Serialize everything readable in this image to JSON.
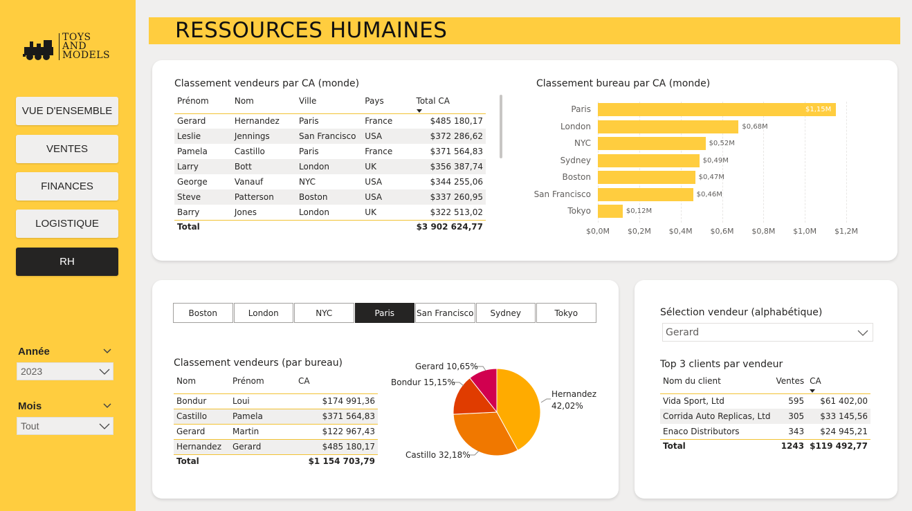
{
  "sidebar": {
    "logo": {
      "line1": "TOYS",
      "line2": "AND",
      "line3": "MODELS"
    },
    "nav": [
      {
        "label": "VUE D'ENSEMBLE",
        "active": false
      },
      {
        "label": "VENTES",
        "active": false
      },
      {
        "label": "FINANCES",
        "active": false
      },
      {
        "label": "LOGISTIQUE",
        "active": false
      },
      {
        "label": "RH",
        "active": true
      }
    ],
    "year_filter": {
      "label": "Année",
      "value": "2023"
    },
    "month_filter": {
      "label": "Mois",
      "value": "Tout"
    }
  },
  "header": {
    "title": "RESSOURCES HUMAINES"
  },
  "sellers_world": {
    "title": "Classement vendeurs par CA (monde)",
    "columns": [
      "Prénom",
      "Nom",
      "Ville",
      "Pays",
      "Total CA"
    ],
    "rows": [
      [
        "Gerard",
        "Hernandez",
        "Paris",
        "France",
        "$485 180,17"
      ],
      [
        "Leslie",
        "Jennings",
        "San Francisco",
        "USA",
        "$372 286,62"
      ],
      [
        "Pamela",
        "Castillo",
        "Paris",
        "France",
        "$371 564,83"
      ],
      [
        "Larry",
        "Bott",
        "London",
        "UK",
        "$356 387,74"
      ],
      [
        "George",
        "Vanauf",
        "NYC",
        "USA",
        "$344 255,06"
      ],
      [
        "Steve",
        "Patterson",
        "Boston",
        "USA",
        "$337 260,95"
      ],
      [
        "Barry",
        "Jones",
        "London",
        "UK",
        "$322 513,02"
      ]
    ],
    "total_label": "Total",
    "total_value": "$3 902 624,77"
  },
  "office_chart": {
    "title": "Classement bureau par CA (monde)",
    "chart_data": {
      "type": "bar",
      "orientation": "horizontal",
      "categories": [
        "Paris",
        "London",
        "NYC",
        "Sydney",
        "Boston",
        "San Francisco",
        "Tokyo"
      ],
      "values": [
        1.15,
        0.68,
        0.52,
        0.49,
        0.47,
        0.46,
        0.12
      ],
      "value_labels": [
        "$1,15M",
        "$0,68M",
        "$0,52M",
        "$0,49M",
        "$0,47M",
        "$0,46M",
        "$0,12M"
      ],
      "xticks": [
        "$0,0M",
        "$0,2M",
        "$0,4M",
        "$0,6M",
        "$0,8M",
        "$1,0M",
        "$1,2M"
      ],
      "xlim": [
        0,
        1.2
      ],
      "color": "#ffcd3f"
    }
  },
  "city_tabs": [
    {
      "label": "Boston",
      "active": false
    },
    {
      "label": "London",
      "active": false
    },
    {
      "label": "NYC",
      "active": false
    },
    {
      "label": "Paris",
      "active": true
    },
    {
      "label": "San Francisco",
      "active": false
    },
    {
      "label": "Sydney",
      "active": false
    },
    {
      "label": "Tokyo",
      "active": false
    }
  ],
  "sellers_office": {
    "title": "Classement vendeurs (par bureau)",
    "columns": [
      "Nom",
      "Prénom",
      "CA"
    ],
    "rows": [
      [
        "Bondur",
        "Loui",
        "$174 991,36"
      ],
      [
        "Castillo",
        "Pamela",
        "$371 564,83"
      ],
      [
        "Gerard",
        "Martin",
        "$122 967,43"
      ],
      [
        "Hernandez",
        "Gerard",
        "$485 180,17"
      ]
    ],
    "total_label": "Total",
    "total_value": "$1 154 703,79"
  },
  "pie_chart": {
    "chart_data": {
      "type": "pie",
      "slices": [
        {
          "name": "Hernandez",
          "value": 42.02,
          "label": "Hernandez",
          "pct": "42,02%",
          "color": "#ffab00"
        },
        {
          "name": "Castillo",
          "value": 32.18,
          "label": "Castillo 32,18%",
          "color": "#f07800"
        },
        {
          "name": "Bondur",
          "value": 15.15,
          "label": "Bondur 15,15%",
          "color": "#e03c00"
        },
        {
          "name": "Gerard",
          "value": 10.65,
          "label": "Gerard 10,65%",
          "color": "#d1004f"
        }
      ]
    }
  },
  "seller_select": {
    "title": "Sélection vendeur (alphabétique)",
    "value": "Gerard"
  },
  "top_clients": {
    "title": "Top 3 clients par vendeur",
    "columns": [
      "Nom du client",
      "Ventes",
      "CA"
    ],
    "rows": [
      [
        "Vida Sport, Ltd",
        "595",
        "$61 402,00"
      ],
      [
        "Corrida Auto Replicas, Ltd",
        "305",
        "$33 145,56"
      ],
      [
        "Enaco Distributors",
        "343",
        "$24 945,21"
      ]
    ],
    "total_label": "Total",
    "total_sales": "1243",
    "total_value": "$119 492,77"
  }
}
